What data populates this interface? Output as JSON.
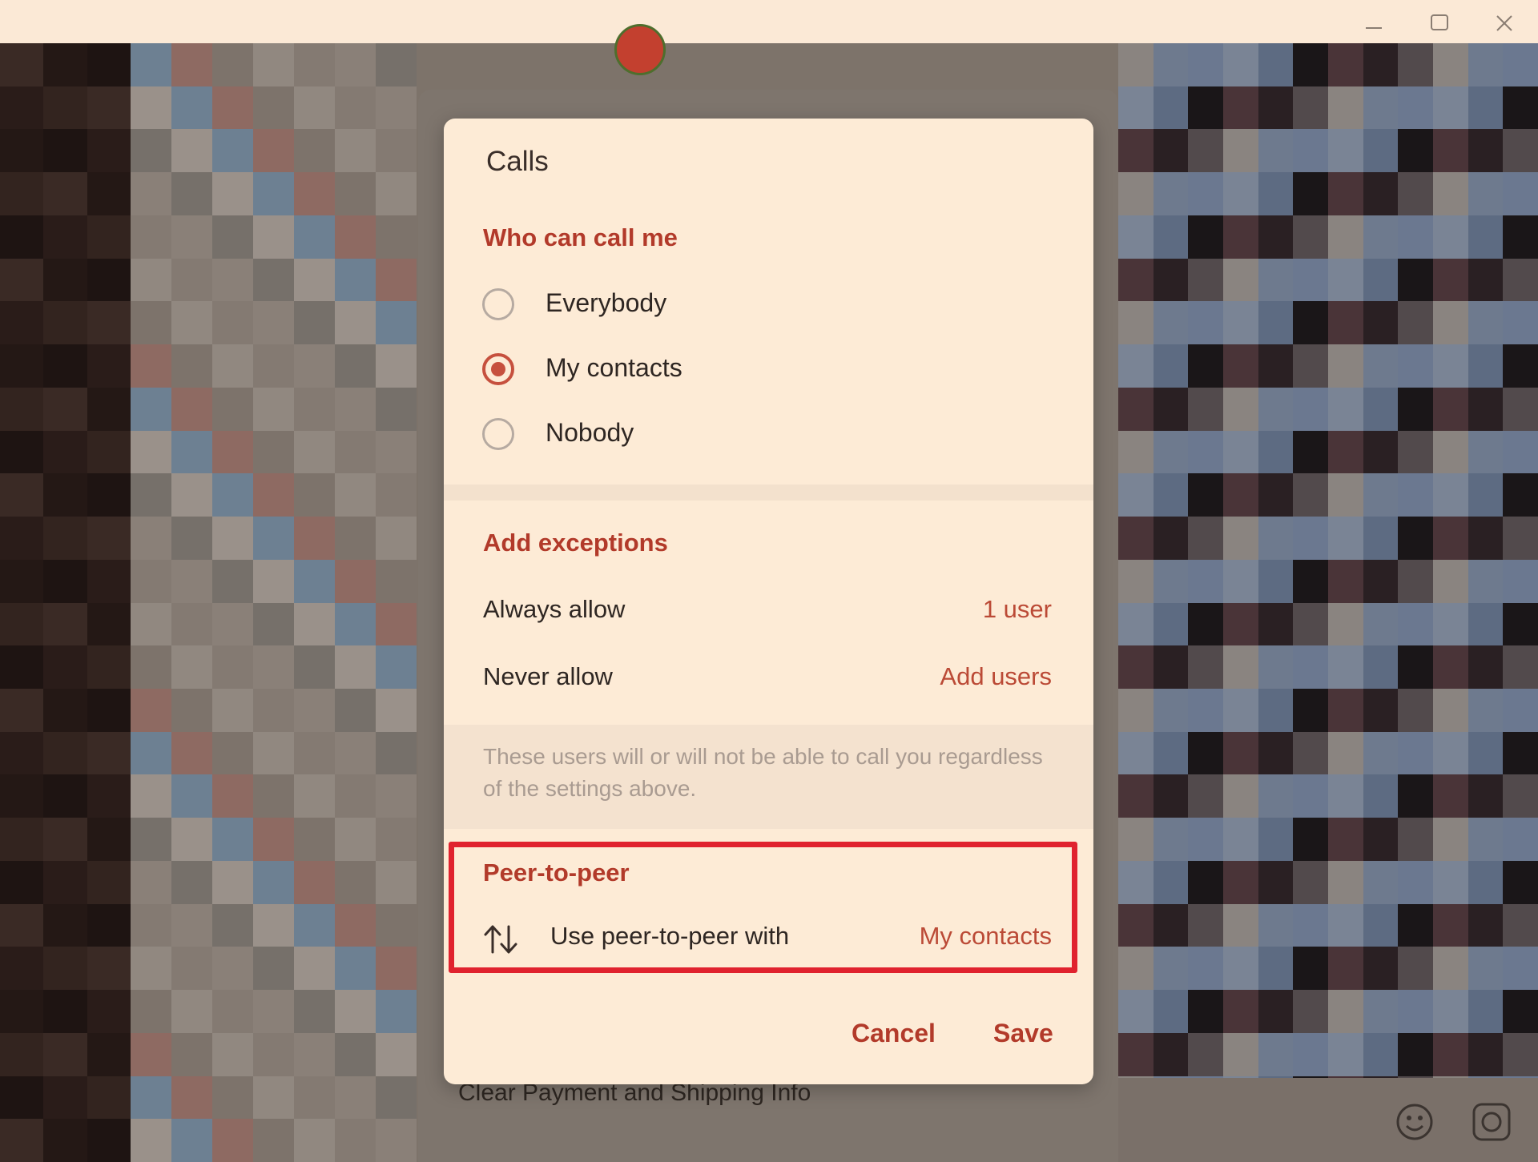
{
  "dialog": {
    "title": "Calls",
    "who_can_call": {
      "heading": "Who can call me",
      "options": [
        {
          "label": "Everybody",
          "selected": false
        },
        {
          "label": "My contacts",
          "selected": true
        },
        {
          "label": "Nobody",
          "selected": false
        }
      ]
    },
    "exceptions": {
      "heading": "Add exceptions",
      "always_allow": {
        "label": "Always allow",
        "value": "1 user"
      },
      "never_allow": {
        "label": "Never allow",
        "value": "Add users"
      },
      "hint": "These users will or will not be able to call you regardless of the settings above."
    },
    "peer_to_peer": {
      "heading": "Peer-to-peer",
      "label": "Use peer-to-peer with",
      "value": "My contacts",
      "icon": "swap-vertical-icon"
    },
    "buttons": {
      "cancel": "Cancel",
      "save": "Save"
    }
  },
  "background": {
    "settings_item": "Clear Payment and Shipping Info"
  },
  "colors": {
    "accent": "#b23a2a",
    "dialog_bg": "#fdebd6",
    "highlight": "#e0222e"
  }
}
